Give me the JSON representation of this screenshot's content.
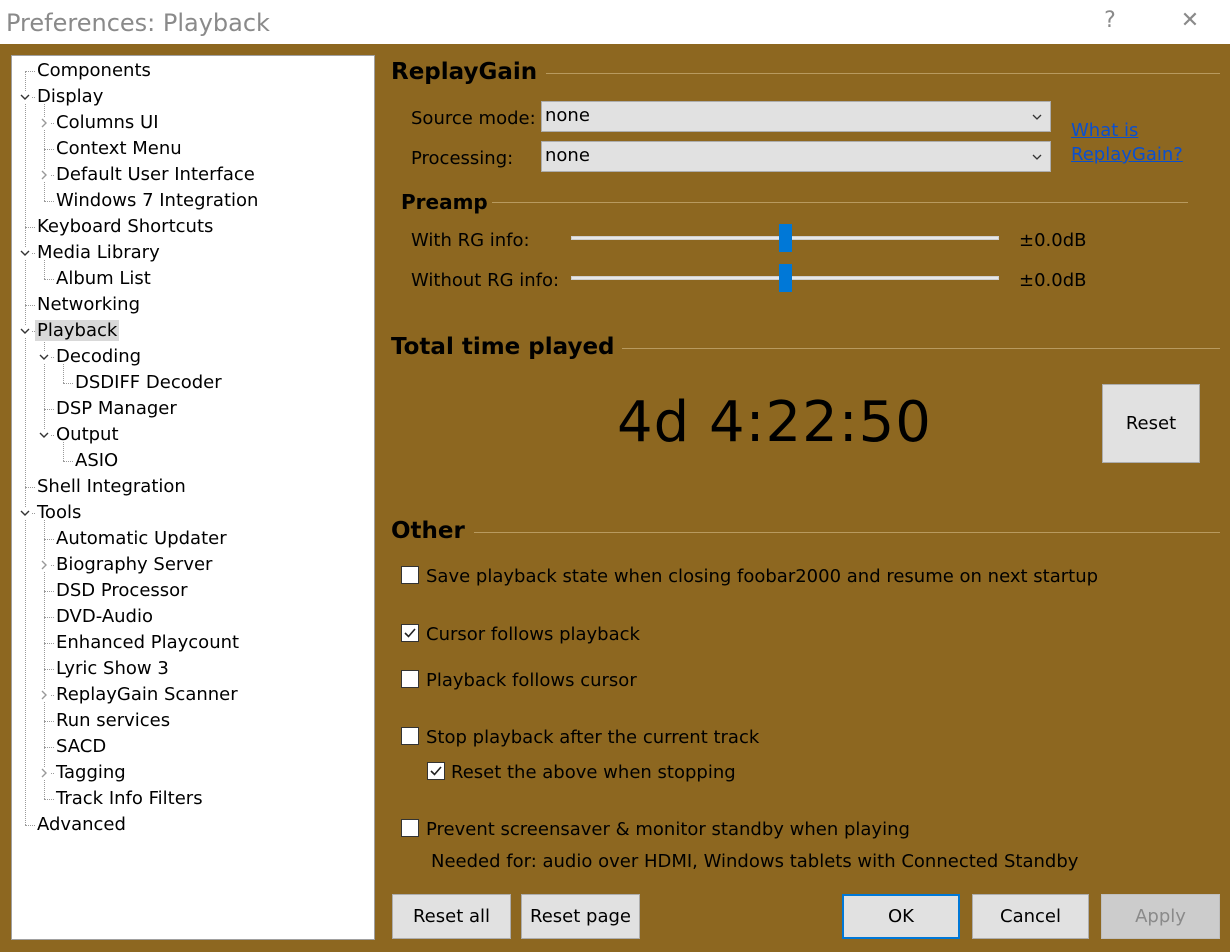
{
  "window": {
    "title": "Preferences: Playback",
    "help_glyph": "?",
    "close_glyph": "✕"
  },
  "tree": [
    {
      "label": "Components",
      "level": 0,
      "expander": "none"
    },
    {
      "label": "Display",
      "level": 0,
      "expander": "open"
    },
    {
      "label": "Columns UI",
      "level": 1,
      "expander": "closed"
    },
    {
      "label": "Context Menu",
      "level": 1,
      "expander": "none"
    },
    {
      "label": "Default User Interface",
      "level": 1,
      "expander": "closed"
    },
    {
      "label": "Windows 7 Integration",
      "level": 1,
      "expander": "none"
    },
    {
      "label": "Keyboard Shortcuts",
      "level": 0,
      "expander": "none"
    },
    {
      "label": "Media Library",
      "level": 0,
      "expander": "open"
    },
    {
      "label": "Album List",
      "level": 1,
      "expander": "none"
    },
    {
      "label": "Networking",
      "level": 0,
      "expander": "none"
    },
    {
      "label": "Playback",
      "level": 0,
      "expander": "open",
      "selected": true
    },
    {
      "label": "Decoding",
      "level": 1,
      "expander": "open"
    },
    {
      "label": "DSDIFF Decoder",
      "level": 2,
      "expander": "none"
    },
    {
      "label": "DSP Manager",
      "level": 1,
      "expander": "none"
    },
    {
      "label": "Output",
      "level": 1,
      "expander": "open"
    },
    {
      "label": "ASIO",
      "level": 2,
      "expander": "none"
    },
    {
      "label": "Shell Integration",
      "level": 0,
      "expander": "none"
    },
    {
      "label": "Tools",
      "level": 0,
      "expander": "open"
    },
    {
      "label": "Automatic Updater",
      "level": 1,
      "expander": "none"
    },
    {
      "label": "Biography Server",
      "level": 1,
      "expander": "closed"
    },
    {
      "label": "DSD Processor",
      "level": 1,
      "expander": "none"
    },
    {
      "label": "DVD-Audio",
      "level": 1,
      "expander": "none"
    },
    {
      "label": "Enhanced Playcount",
      "level": 1,
      "expander": "none"
    },
    {
      "label": "Lyric Show 3",
      "level": 1,
      "expander": "none"
    },
    {
      "label": "ReplayGain Scanner",
      "level": 1,
      "expander": "closed"
    },
    {
      "label": "Run services",
      "level": 1,
      "expander": "none"
    },
    {
      "label": "SACD",
      "level": 1,
      "expander": "none"
    },
    {
      "label": "Tagging",
      "level": 1,
      "expander": "closed"
    },
    {
      "label": "Track Info Filters",
      "level": 1,
      "expander": "none"
    },
    {
      "label": "Advanced",
      "level": 0,
      "expander": "none"
    }
  ],
  "replaygain": {
    "title": "ReplayGain",
    "source_mode_label": "Source mode:",
    "source_mode_value": "none",
    "processing_label": "Processing:",
    "processing_value": "none",
    "link_line1": "What is",
    "link_line2": "ReplayGain?"
  },
  "preamp": {
    "title": "Preamp",
    "with_rg_label": "With RG info:",
    "with_rg_value": "±0.0dB",
    "with_rg_level": 0.5,
    "without_rg_label": "Without RG info:",
    "without_rg_value": "±0.0dB",
    "without_rg_level": 0.5
  },
  "total_time": {
    "title": "Total time played",
    "value": "4d 4:22:50",
    "reset_label": "Reset"
  },
  "other": {
    "title": "Other",
    "save_state": {
      "label": "Save playback state when closing foobar2000 and resume on next startup",
      "checked": false
    },
    "cursor_follows": {
      "label": "Cursor follows playback",
      "checked": true
    },
    "playback_follows": {
      "label": "Playback follows cursor",
      "checked": false
    },
    "stop_after": {
      "label": "Stop playback after the current track",
      "checked": false
    },
    "reset_above": {
      "label": "Reset the above when stopping",
      "checked": true
    },
    "prevent_screensaver": {
      "label": "Prevent screensaver & monitor standby when playing",
      "checked": false
    },
    "needed_for": "Needed for: audio over HDMI, Windows tablets with Connected Standby"
  },
  "buttons": {
    "reset_all": "Reset all",
    "reset_page": "Reset page",
    "ok": "OK",
    "cancel": "Cancel",
    "apply": "Apply"
  },
  "colors": {
    "background": "#8d6720",
    "slider_thumb": "#0078d7",
    "link": "#0a4fcf"
  }
}
